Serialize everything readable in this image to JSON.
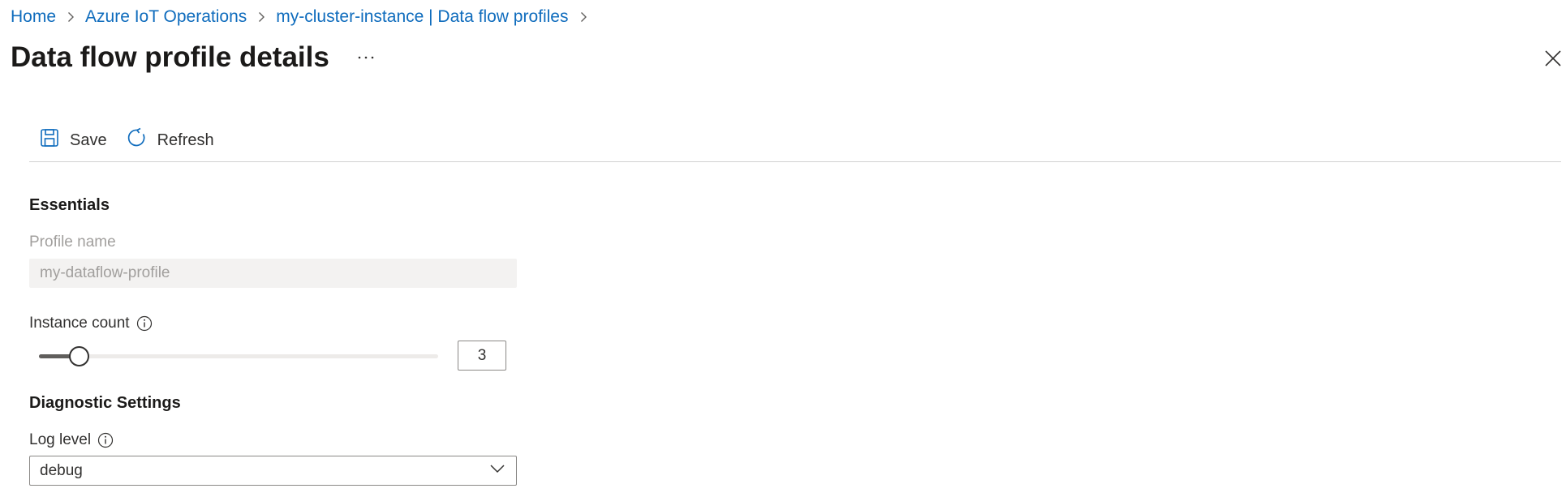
{
  "breadcrumb": {
    "items": [
      "Home",
      "Azure IoT Operations",
      "my-cluster-instance | Data flow profiles"
    ]
  },
  "page": {
    "title": "Data flow profile details",
    "more_icon": "ellipsis-icon",
    "close_icon": "close-icon"
  },
  "toolbar": {
    "save_label": "Save",
    "save_icon": "save-icon",
    "refresh_label": "Refresh",
    "refresh_icon": "refresh-icon"
  },
  "essentials": {
    "heading": "Essentials",
    "profile_name_label": "Profile name",
    "profile_name_value": "my-dataflow-profile",
    "instance_count_label": "Instance count",
    "instance_count_value": "3",
    "instance_count_slider_fraction": 0.1
  },
  "diagnostics": {
    "heading": "Diagnostic Settings",
    "log_level_label": "Log level",
    "log_level_value": "debug"
  },
  "colors": {
    "link": "#0f6cbd",
    "text": "#323130",
    "disabled_text": "#a19f9d",
    "divider": "#d1d1d1"
  }
}
